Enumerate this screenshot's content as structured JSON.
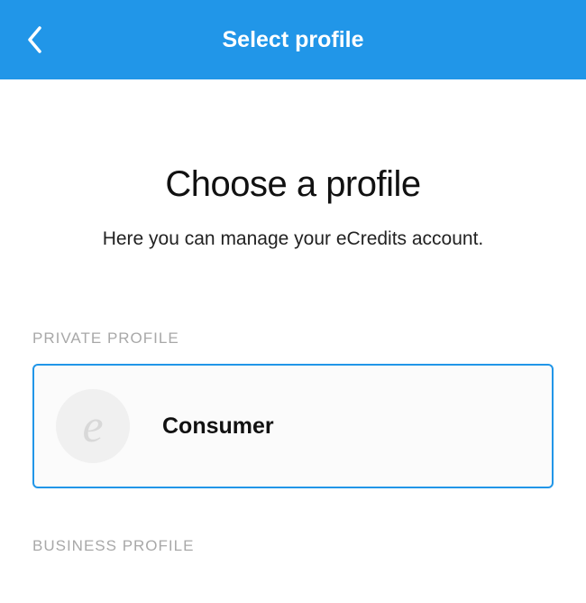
{
  "header": {
    "title": "Select profile"
  },
  "main": {
    "heading": "Choose a profile",
    "subheading": "Here you can manage your eCredits account."
  },
  "sections": {
    "private": {
      "label": "PRIVATE PROFILE",
      "profile": {
        "icon_letter": "e",
        "name": "Consumer"
      }
    },
    "business": {
      "label": "BUSINESS PROFILE"
    }
  },
  "colors": {
    "header_bg": "#2196e8",
    "card_border": "#2196e8",
    "section_label": "#a8a8a8"
  }
}
